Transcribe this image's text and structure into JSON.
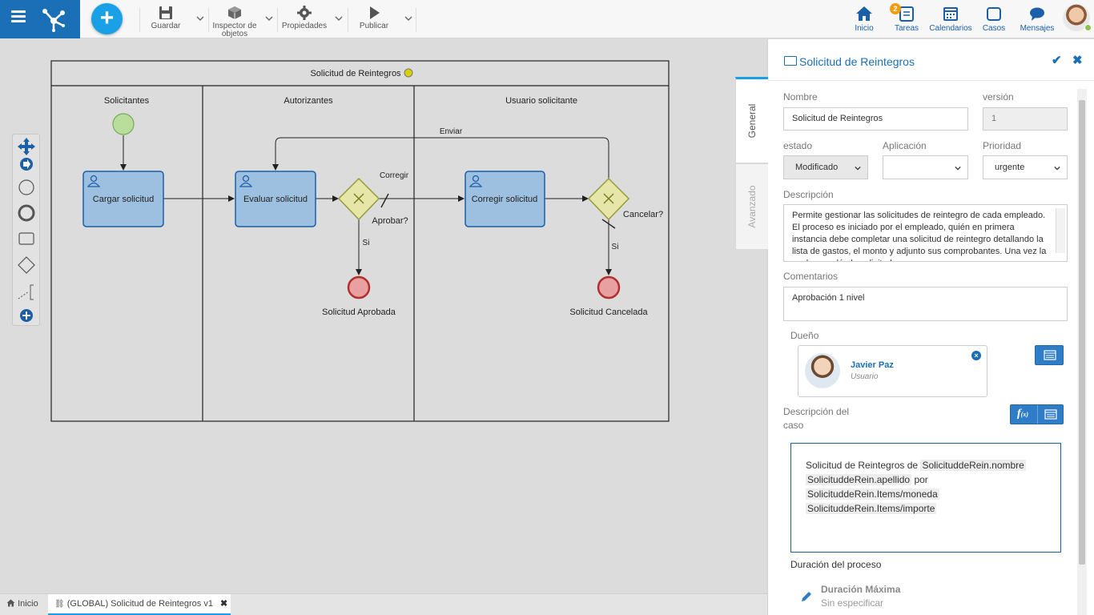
{
  "toolbar": {
    "save_label": "Guardar",
    "inspector_label_1": "Inspector de",
    "inspector_label_2": "objetos",
    "properties_label": "Propiedades",
    "publish_label": "Publicar"
  },
  "nav": {
    "home_label": "Inicio",
    "tasks_label": "Tareas",
    "tasks_badge": "2",
    "calendars_label": "Calendarios",
    "cases_label": "Casos",
    "messages_label": "Mensajes"
  },
  "diagram": {
    "pool_title": "Solicitud de Reintegros",
    "lanes": [
      "Solicitantes",
      "Autorizantes",
      "Usuario solicitante"
    ],
    "tasks": [
      "Cargar solicitud",
      "Evaluar solicitud",
      "Corregir solicitud"
    ],
    "gateway_labels": [
      "Aprobar?",
      "Cancelar?"
    ],
    "flow_labels": [
      "Enviar",
      "Corregir",
      "Si",
      "Si"
    ],
    "end_events": [
      "Solicitud Aprobada",
      "Solicitud Cancelada"
    ]
  },
  "panel": {
    "title": "Solicitud de Reintegros",
    "tabs": [
      "General",
      "Avanzado"
    ],
    "fields": {
      "name_label": "Nombre",
      "name_value": "Solicitud de Reintegros",
      "version_label": "versión",
      "version_value": "1",
      "state_label": "estado",
      "state_value": "Modificado",
      "app_label": "Aplicación",
      "app_value": "",
      "priority_label": "Prioridad",
      "priority_value": "urgente",
      "desc_label": "Descripción",
      "desc_value": "Permite gestionar las solicitudes de reintegro de cada empleado. El proceso es iniciado por el empleado, quién en primera instancia debe completar una solicitud de reintegro detallando la lista de gastos, el monto y adjunto sus comprobantes. Una vez la cual se evalúe la solicitud.",
      "comments_label": "Comentarios",
      "comments_value": "Aprobación 1 nivel",
      "owner_label": "Dueño",
      "owner_name": "Javier Paz",
      "owner_role": "Usuario",
      "case_desc_label_1": "Descripción del",
      "case_desc_label_2": "caso",
      "case_desc_prefix": "Solicitud de Reintegros de",
      "case_desc_token_1": "SolicituddeRein.nombre",
      "case_desc_token_2": "SolicituddeRein.apellido",
      "case_desc_mid": "por",
      "case_desc_token_3": "SolicituddeRein.Items/moneda",
      "case_desc_token_4": "SolicituddeRein.Items/importe",
      "duration_label": "Duración del proceso",
      "max_duration_label": "Duración Máxima",
      "max_duration_value": "Sin especificar"
    }
  },
  "bottom_tabs": {
    "home": "Inicio",
    "current": "(GLOBAL) Solicitud de Reintegros v1"
  },
  "colors": {
    "brand": "#1a6fb6",
    "accent": "#1aa0e6",
    "task_fill": "#9ec0e0",
    "gateway_fill": "#e6e6a8",
    "start_fill": "#b9dd9a",
    "end_fill": "#e8a0a0"
  }
}
